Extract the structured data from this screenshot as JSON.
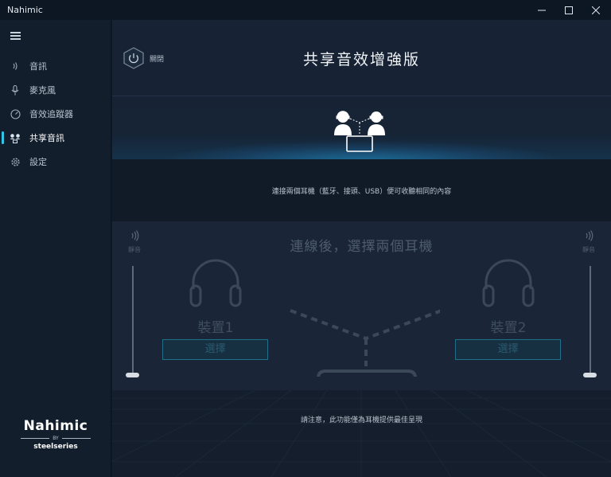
{
  "window": {
    "title": "Nahimic"
  },
  "sidebar": {
    "items": [
      {
        "label": "音訊",
        "icon": "audio-wave-icon",
        "active": false
      },
      {
        "label": "麥克風",
        "icon": "microphone-icon",
        "active": false
      },
      {
        "label": "音效追蹤器",
        "icon": "sound-tracker-icon",
        "active": false
      },
      {
        "label": "共享音訊",
        "icon": "sound-sharing-icon",
        "active": true
      },
      {
        "label": "設定",
        "icon": "gear-icon",
        "active": false
      }
    ],
    "brand": {
      "logo": "Nahimic",
      "by": "BY",
      "maker": "steelseries"
    }
  },
  "header": {
    "power_label": "關閉",
    "title": "共享音效增強版"
  },
  "description": "連接兩個耳機（藍牙、接頭、USB）便可收聽相同的內容",
  "connect": {
    "title": "連線後，選擇兩個耳機",
    "mute_label": "靜音",
    "device1": {
      "label": "裝置1",
      "button": "選擇"
    },
    "device2": {
      "label": "裝置2",
      "button": "選擇"
    }
  },
  "footer_note": "請注意，此功能僅為耳機提供最佳呈現",
  "colors": {
    "accent": "#2fc7e8",
    "background": "#172232",
    "sidebar": "#131e2c"
  }
}
